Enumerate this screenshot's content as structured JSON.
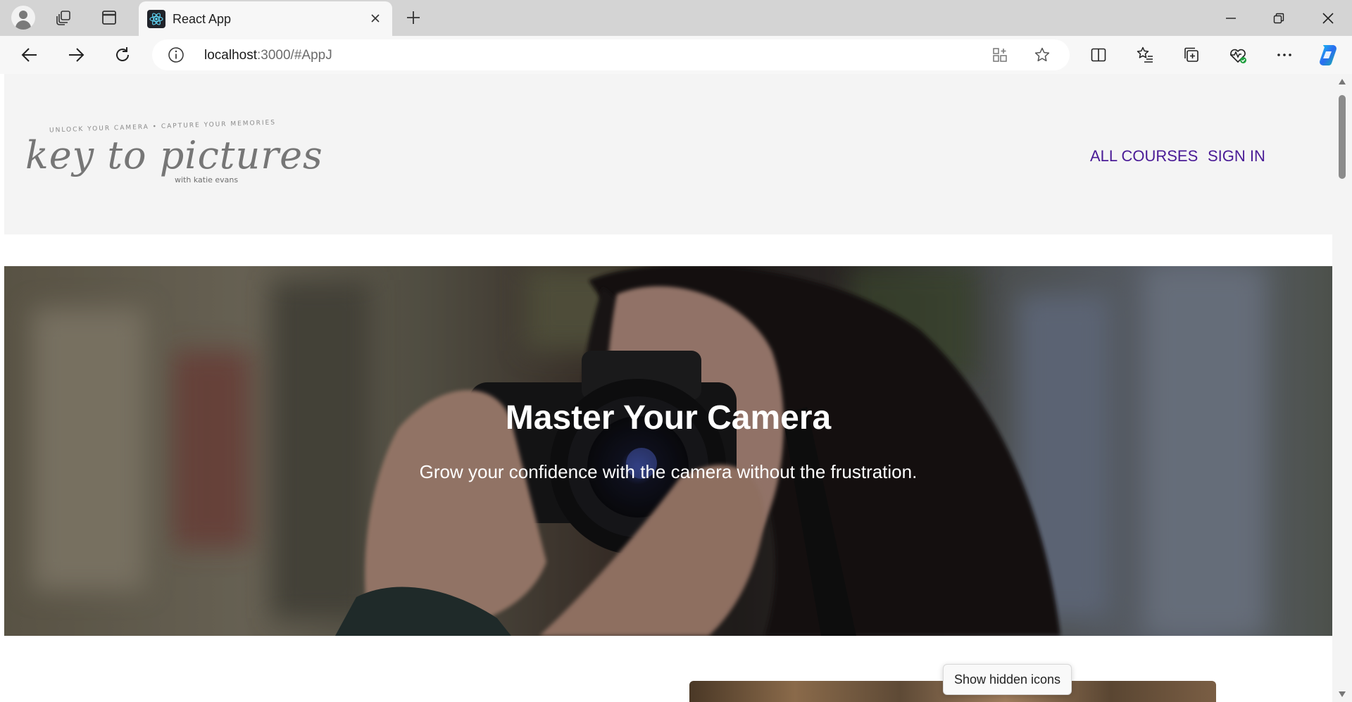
{
  "browser": {
    "tab_title": "React App",
    "url_host": "localhost",
    "url_rest": ":3000/#AppJ"
  },
  "site": {
    "logo": {
      "tagline": "UNLOCK YOUR CAMERA  •  CAPTURE YOUR MEMORIES",
      "wordmark": "key to pictures",
      "byline": "with katie evans"
    },
    "nav": {
      "all_courses": "ALL COURSES",
      "sign_in": "SIGN IN"
    },
    "hero": {
      "title": "Master Your Camera",
      "subtitle": "Grow your confidence with the camera without the frustration."
    }
  },
  "tooltip": {
    "text": "Show hidden icons"
  },
  "colors": {
    "nav_link": "#4a1b96",
    "header_bg": "#f4f4f4",
    "titlebar_bg": "#d4d4d4"
  }
}
